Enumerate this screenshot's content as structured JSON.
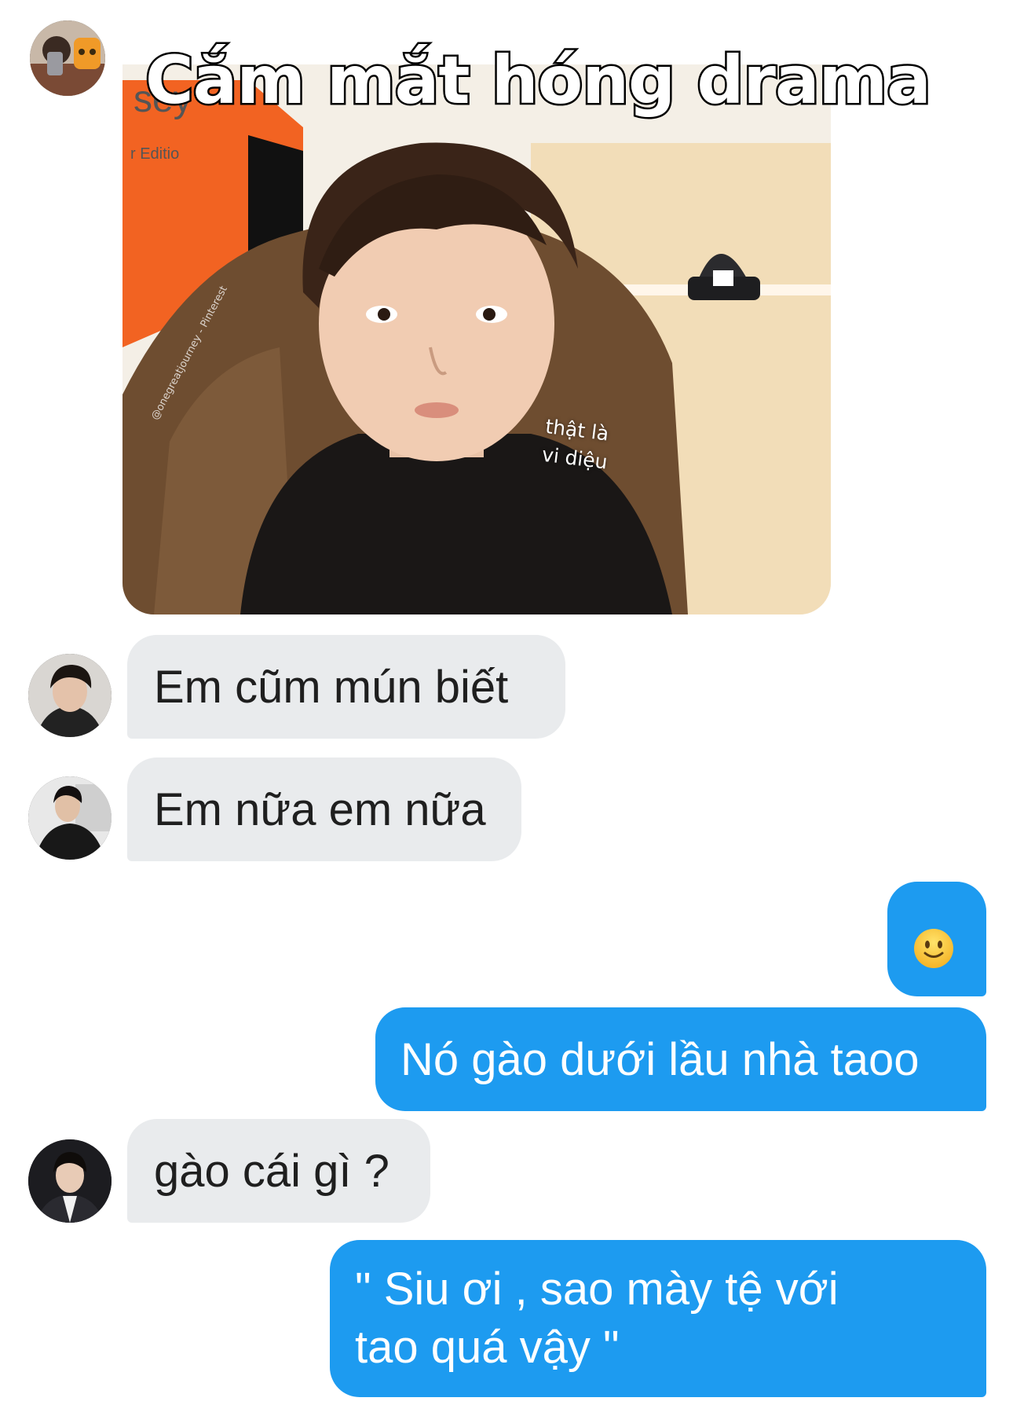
{
  "meme": {
    "caption": "Cắm mắt hóng drama",
    "sticker_line1": "thật là",
    "sticker_line2": "vi diệu",
    "watermark": "@onegreatjourney - Pinterest"
  },
  "messages": [
    {
      "id": "m1",
      "direction": "in",
      "text": "Em cũm mún biết"
    },
    {
      "id": "m2",
      "direction": "in",
      "text": "Em nữa em nữa"
    },
    {
      "id": "m3",
      "direction": "out",
      "emoji": "slightly-smiling-face"
    },
    {
      "id": "m4",
      "direction": "out",
      "text": "Nó gào dưới lầu nhà taoo"
    },
    {
      "id": "m5",
      "direction": "in",
      "text": "gào cái gì ?"
    },
    {
      "id": "m6",
      "direction": "out",
      "line1": " \" Siu ơi , sao mày tệ với",
      "line2": "tao quá vậy \""
    }
  ],
  "colors": {
    "incoming_bubble": "#e9ebed",
    "outgoing_bubble": "#1d9bf0",
    "incoming_text": "#1f1f1f",
    "outgoing_text": "#ffffff"
  },
  "icons": {
    "emoji": "slightly-smiling-face-icon"
  }
}
